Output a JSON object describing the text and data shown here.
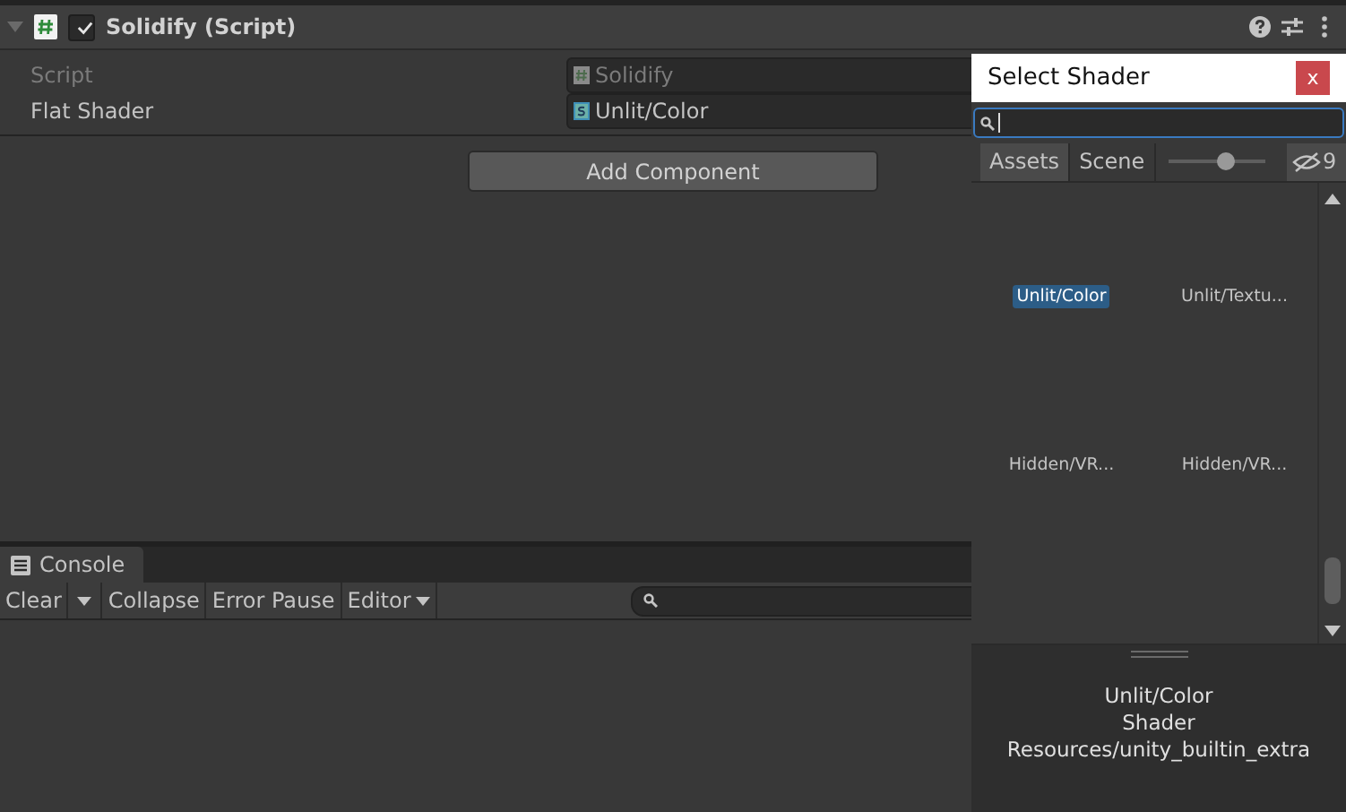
{
  "component": {
    "title": "Solidify (Script)",
    "expanded": true,
    "enabled": true,
    "properties": [
      {
        "label": "Script",
        "value": "Solidify",
        "disabled": true,
        "kind": "script"
      },
      {
        "label": "Flat Shader",
        "value": "Unlit/Color",
        "disabled": false,
        "kind": "shader"
      }
    ]
  },
  "add_component": "Add Component",
  "console": {
    "tab": "Console",
    "toolbar": [
      {
        "label": "Clear",
        "kind": "split"
      },
      {
        "label": "Collapse",
        "kind": "toggle"
      },
      {
        "label": "Error Pause",
        "kind": "toggle"
      },
      {
        "label": "Editor",
        "kind": "dropdown"
      }
    ]
  },
  "picker": {
    "title": "Select Shader",
    "close": "x",
    "tabs": [
      {
        "label": "Assets",
        "selected": true
      },
      {
        "label": "Scene",
        "selected": false
      }
    ],
    "size_slider": {
      "level": 0.6
    },
    "hidden_count": "9",
    "items": [
      {
        "label": "Unlit/Color",
        "selected": true
      },
      {
        "label": "Unlit/Textu...",
        "selected": false
      },
      {
        "label": "Hidden/VR...",
        "selected": false
      },
      {
        "label": "Hidden/VR...",
        "selected": false
      }
    ],
    "preview": [
      "Unlit/Color",
      "Shader",
      "Resources/unity_builtin_extra"
    ]
  }
}
